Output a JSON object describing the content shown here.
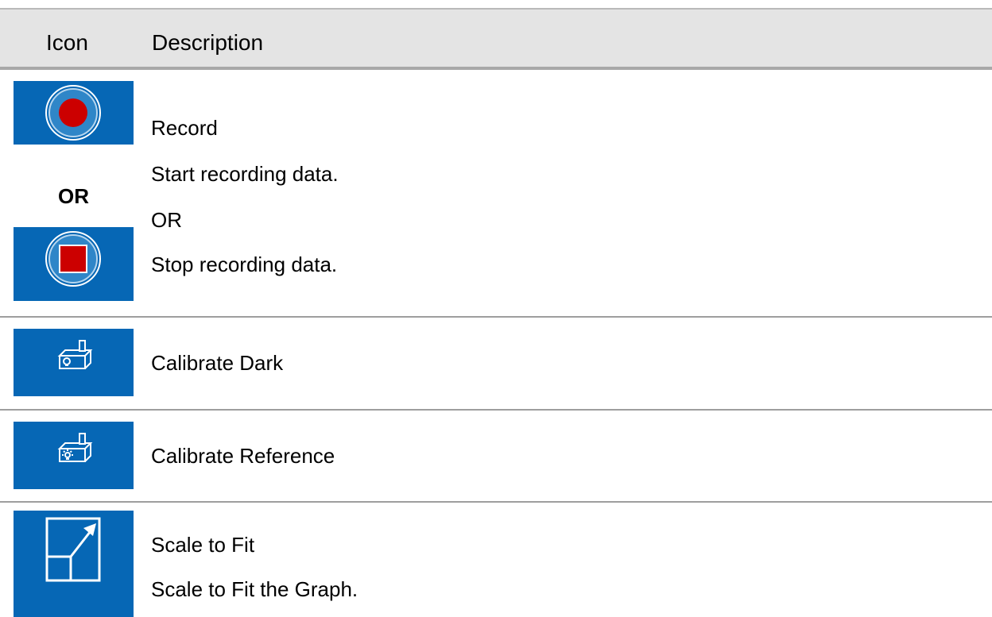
{
  "header": {
    "icon_col": "Icon",
    "description_col": "Description"
  },
  "rows": [
    {
      "title": "Record",
      "icon_or": "OR",
      "icons": [
        "record-start-icon",
        "record-stop-icon"
      ],
      "lines": [
        "Start recording data.",
        "OR",
        "Stop recording data."
      ]
    },
    {
      "title": "Calibrate Dark",
      "icons": [
        "calibrate-dark-icon"
      ]
    },
    {
      "title": "Calibrate Reference",
      "icons": [
        "calibrate-reference-icon"
      ]
    },
    {
      "title": "Scale to Fit",
      "icons": [
        "scale-to-fit-icon"
      ],
      "lines": [
        "Scale to Fit the Graph."
      ]
    }
  ],
  "colors": {
    "tile_blue": "#0667b5",
    "record_red": "#cc0000",
    "header_bg": "#e4e4e4"
  }
}
